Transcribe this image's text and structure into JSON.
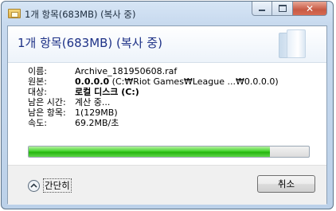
{
  "window": {
    "title": "1개 항목(683MB) (복사 중)",
    "caption_buttons": {
      "minimize": "minimize-icon",
      "maximize": "maximize-icon",
      "close": "✕"
    }
  },
  "header": {
    "title": "1개 항목(683MB) (복사 중)"
  },
  "details": [
    {
      "label": "이름:",
      "value": "Archive_181950608.raf",
      "bold": false
    },
    {
      "label": "원본:",
      "value_bold": "0.0.0.0",
      "value_rest": " (C:₩Riot Games₩League ...₩0.0.0.0)"
    },
    {
      "label": "대상:",
      "value": "로컬 디스크 (C:)",
      "bold": true
    },
    {
      "label": "남은 시간:",
      "value": "계산 중..."
    },
    {
      "label": "남은 항목:",
      "value": "1(129MB)"
    },
    {
      "label": "속도:",
      "value": "69.2MB/초"
    }
  ],
  "progress": {
    "percent": 86,
    "color": "#2fc41a"
  },
  "footer": {
    "collapse_label": "간단히",
    "cancel_label": "취소"
  },
  "icons": [
    "folder-copy-icon",
    "chevron-up-icon",
    "minimize-icon",
    "maximize-icon",
    "close-icon"
  ]
}
